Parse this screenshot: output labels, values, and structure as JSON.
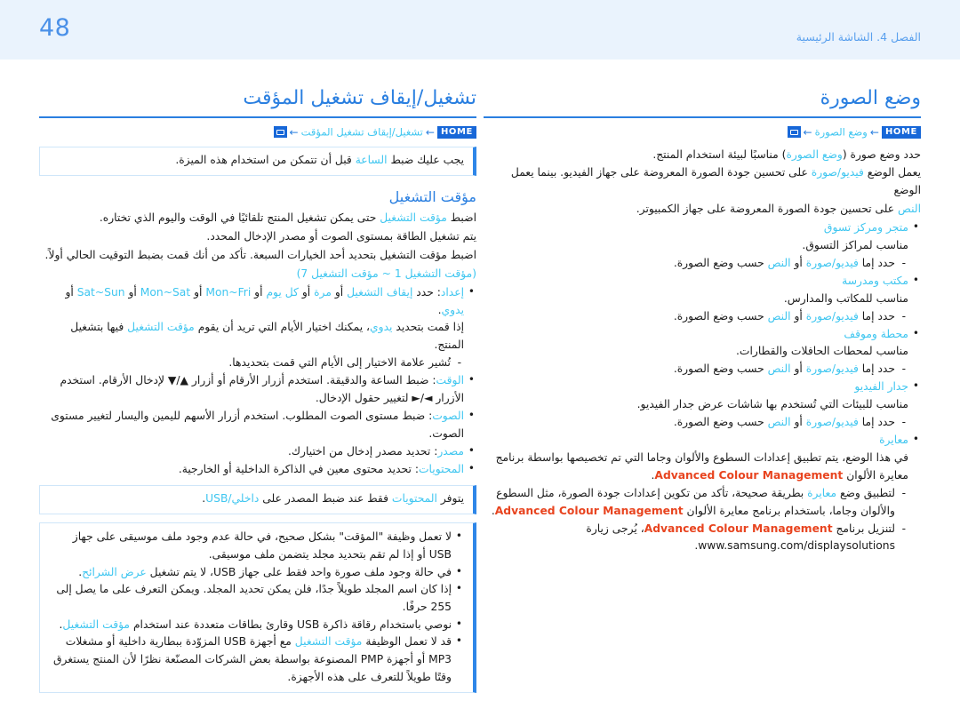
{
  "header": {
    "page_number": "48",
    "chapter_label": "الفصل 4. الشاشة الرئيسية"
  },
  "right_column": {
    "title": "وضع الصورة",
    "breadcrumb": {
      "home_label": "HOME",
      "arrow": "←",
      "enter_icon": "enter-icon",
      "path_label": "وضع الصورة"
    },
    "intro": [
      {
        "pre": "حدد وضع صورة (",
        "hl": "وضع الصورة",
        "post": ") مناسبًا لبيئة استخدام المنتج."
      },
      {
        "pre": "يعمل الوضع ",
        "hl": "فيديو/صورة",
        "post": " على تحسين جودة الصورة المعروضة على جهاز الفيديو. بينما يعمل الوضع"
      },
      {
        "pre": "",
        "hl": "النص",
        "post": " على تحسين جودة الصورة المعروضة على جهاز الكمبيوتر."
      }
    ],
    "items": [
      {
        "label": "متجر ومركز تسوق",
        "desc": "مناسب لمراكز التسوق.",
        "sub_pre": "حدد إما ",
        "sub_hl1": "فيديو/صورة",
        "sub_mid": " أو ",
        "sub_hl2": "النص",
        "sub_post": " حسب وضع الصورة."
      },
      {
        "label": "مكتب ومدرسة",
        "desc": "مناسب للمكاتب والمدارس.",
        "sub_pre": "حدد إما ",
        "sub_hl1": "فيديو/صورة",
        "sub_mid": " أو ",
        "sub_hl2": "النص",
        "sub_post": " حسب وضع الصورة."
      },
      {
        "label": "محطة وموقف",
        "desc": "مناسب لمحطات الحافلات والقطارات.",
        "sub_pre": "حدد إما ",
        "sub_hl1": "فيديو/صورة",
        "sub_mid": " أو ",
        "sub_hl2": "النص",
        "sub_post": " حسب وضع الصورة."
      },
      {
        "label": "جدار الفيديو",
        "desc": "مناسب للبيئات التي تُستخدم بها شاشات عرض جدار الفيديو.",
        "sub_pre": "حدد إما ",
        "sub_hl1": "فيديو/صورة",
        "sub_mid": " أو ",
        "sub_hl2": "النص",
        "sub_post": " حسب وضع الصورة."
      }
    ],
    "calibration": {
      "label": "معايرة",
      "desc_pre": "في هذا الوضع، يتم تطبيق إعدادات السطوع والألوان وجاما التي تم تخصيصها بواسطة برنامج معايرة الألوان ",
      "desc_brand": "Advanced Colour Management",
      "desc_post": ".",
      "sub1_pre": "لتطبيق وضع ",
      "sub1_hl": "معايرة",
      "sub1_mid": " بطريقة صحيحة، تأكد من تكوين إعدادات جودة الصورة، مثل السطوع والألوان وجاما، باستخدام برنامج معايرة الألوان ",
      "sub1_brand": "Advanced Colour Management",
      "sub1_post": ".",
      "sub2_pre": "لتنزيل برنامج ",
      "sub2_brand": "Advanced Colour Management",
      "sub2_mid": "، يُرجى زيارة ",
      "sub2_url": "www.samsung.com/displaysolutions",
      "sub2_post": "."
    }
  },
  "left_column": {
    "title": "تشغيل/إيقاف تشغيل المؤقت",
    "breadcrumb": {
      "home_label": "HOME",
      "arrow": "←",
      "enter_icon": "enter-icon",
      "path_label": "تشغيل/إيقاف تشغيل المؤقت"
    },
    "note_clock": {
      "pre": "يجب عليك ضبط ",
      "hl": "الساعة",
      "post": " قبل أن تتمكن من استخدام هذه الميزة."
    },
    "sub_title": "مؤقت التشغيل",
    "intro": [
      {
        "pre": "اضبط ",
        "hl": "مؤقت التشغيل",
        "post": " حتى يمكن تشغيل المنتج تلقائيًا في الوقت واليوم الذي تختاره."
      },
      {
        "pre": "يتم تشغيل الطاقة بمستوى الصوت أو مصدر الإدخال المحدد.",
        "hl": "",
        "post": ""
      },
      {
        "pre": "اضبط مؤقت التشغيل بتحديد أحد الخيارات السبعة. تأكد من أنك قمت بضبط التوقيت الحالي أولاً.",
        "hl": "",
        "post": ""
      }
    ],
    "range_note": "(مؤقت التشغيل 1 ~ مؤقت التشغيل 7)",
    "bullets": [
      {
        "label": "إعداد",
        "sep": ": ",
        "text_pre": "حدد ",
        "options": [
          "إيقاف التشغيل",
          "مرة",
          "كل يوم",
          "Mon~Fri",
          "Mon~Sat",
          "Sat~Sun",
          "يدوي"
        ],
        "option_sep": " أو ",
        "text_post": ".",
        "extra_pre": "إذا قمت بتحديد ",
        "extra_hl1": "يدوي",
        "extra_mid": "، يمكنك اختيار الأيام التي تريد أن يقوم ",
        "extra_hl2": "مؤقت التشغيل",
        "extra_post": " فيها بتشغيل المنتج.",
        "sub": "تُشير علامة الاختيار إلى الأيام التي قمت بتحديدها."
      },
      {
        "label": "الوقت",
        "sep": ": ",
        "text": "ضبط الساعة والدقيقة. استخدم أزرار الأرقام أو أزرار ▲/▼ لإدخال الأرقام. استخدم الأزرار ◄/► لتغيير حقول الإدخال."
      },
      {
        "label": "الصوت",
        "sep": ": ",
        "text": "ضبط مستوى الصوت المطلوب. استخدم أزرار الأسهم لليمين واليسار لتغيير مستوى الصوت."
      },
      {
        "label": "مصدر",
        "sep": ": ",
        "text": "تحديد مصدر إدخال من اختيارك."
      },
      {
        "label": "المحتويات",
        "sep": ": ",
        "text": "تحديد محتوى معين في الذاكرة الداخلية أو الخارجية."
      }
    ],
    "note_contents": {
      "pre": "يتوفر ",
      "hl1": "المحتويات",
      "mid": " فقط عند ضبط المصدر على ",
      "hl2": "داخلي/USB",
      "post": "."
    },
    "note_usb": [
      {
        "pre": "لا تعمل وظيفة \"المؤقت\" بشكل صحيح، في حالة عدم وجود ملف موسيقى على جهاز USB أو إذا لم تقم بتحديد مجلد يتضمن ملف موسيقى.",
        "hl": "",
        "post": ""
      },
      {
        "pre": "في حالة وجود ملف صورة واحد فقط على جهاز USB، لا يتم تشغيل ",
        "hl": "عرض الشرائح",
        "post": "."
      },
      {
        "pre": "إذا كان اسم المجلد طويلاً جدًا، فلن يمكن تحديد المجلد. ويمكن التعرف على ما يصل إلى 255 حرفًا.",
        "hl": "",
        "post": ""
      },
      {
        "pre": "نوصي باستخدام رقاقة ذاكرة USB وقارئ بطاقات متعددة عند استخدام ",
        "hl": "مؤقت التشغيل",
        "post": "."
      },
      {
        "pre": "قد لا تعمل الوظيفة ",
        "hl": "مؤقت التشغيل",
        "post": " مع أجهزة USB المزوّدة ببطارية داخلية أو مشغلات MP3 أو أجهزة PMP المصنوعة بواسطة بعض الشركات المصنّعة نظرًا لأن المنتج يستغرق وقتًا طويلاً للتعرف على هذه الأجهزة."
      }
    ]
  }
}
